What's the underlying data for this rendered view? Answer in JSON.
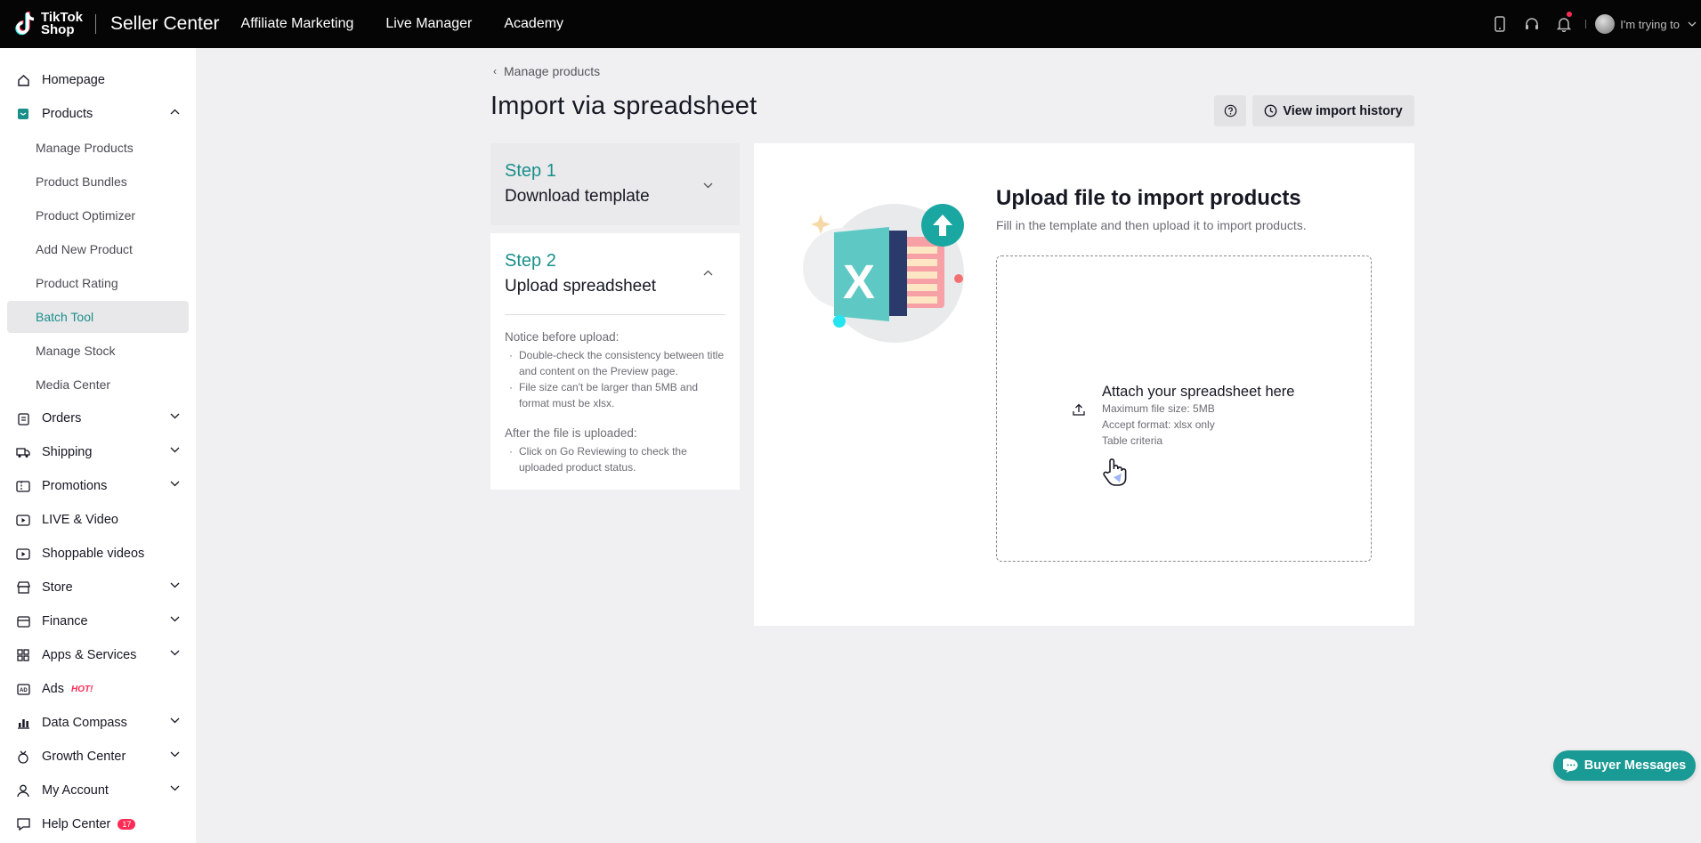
{
  "topbar": {
    "logo_text_line1": "TikTok",
    "logo_text_line2": "Shop",
    "product_name": "Seller Center",
    "nav": [
      "Affiliate Marketing",
      "Live Manager",
      "Academy"
    ],
    "username": "I'm trying to",
    "icons": [
      "phone-icon",
      "headset-icon",
      "bell-icon",
      "avatar"
    ]
  },
  "sidebar": {
    "items": [
      {
        "label": "Homepage",
        "icon": "home-icon"
      },
      {
        "label": "Products",
        "icon": "products-icon",
        "expanded": true
      },
      {
        "label": "Orders",
        "icon": "orders-icon"
      },
      {
        "label": "Shipping",
        "icon": "shipping-icon"
      },
      {
        "label": "Promotions",
        "icon": "promotions-icon"
      },
      {
        "label": "LIVE & Video",
        "icon": "live-icon"
      },
      {
        "label": "Shoppable videos",
        "icon": "video-icon"
      },
      {
        "label": "Store",
        "icon": "store-icon"
      },
      {
        "label": "Finance",
        "icon": "finance-icon"
      },
      {
        "label": "Apps & Services",
        "icon": "apps-icon"
      },
      {
        "label": "Ads",
        "icon": "ads-icon",
        "badge": "HOT!"
      },
      {
        "label": "Data Compass",
        "icon": "chart-icon"
      },
      {
        "label": "Growth Center",
        "icon": "growth-icon"
      },
      {
        "label": "My Account",
        "icon": "account-icon"
      },
      {
        "label": "Help Center",
        "icon": "help-icon",
        "badge": "17"
      }
    ],
    "product_sub": [
      "Manage Products",
      "Product Bundles",
      "Product Optimizer",
      "Add New Product",
      "Product Rating",
      "Batch Tool",
      "Manage Stock",
      "Media Center"
    ],
    "active_sub": "Batch Tool"
  },
  "page": {
    "breadcrumb": "Manage products",
    "title": "Import via spreadsheet",
    "view_history": "View import history"
  },
  "steps": {
    "step1_num": "Step 1",
    "step1_name": "Download template",
    "step2_num": "Step 2",
    "step2_name": "Upload spreadsheet",
    "notice_title": "Notice before upload:",
    "notice_items": [
      "Double-check the consistency between title and content on the Preview page.",
      "File size can't be larger than 5MB and format must be xlsx."
    ],
    "after_title": "After the file is uploaded:",
    "after_items": [
      "Click on Go Reviewing to check the uploaded product status."
    ]
  },
  "upload": {
    "title": "Upload file to import products",
    "subtitle": "Fill in the template and then upload it to import products.",
    "dropzone_title": "Attach your spreadsheet here",
    "max_size": "Maximum file size: 5MB",
    "format": "Accept format: xlsx only",
    "criteria": "Table criteria"
  },
  "buyer_messages": "Buyer Messages",
  "colors": {
    "accent": "#1a8f8a",
    "badge": "#fe2c55",
    "topbar": "#050505"
  }
}
